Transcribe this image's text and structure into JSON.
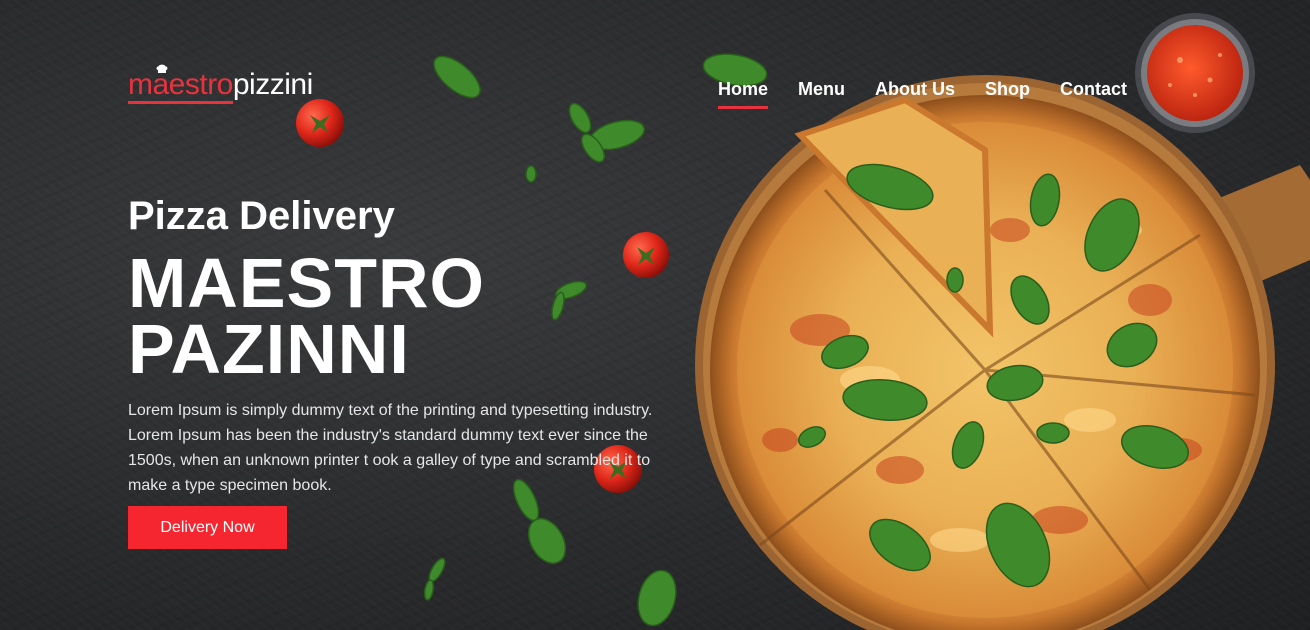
{
  "brand": {
    "part1": "maestro",
    "part2": "pizzini"
  },
  "nav": [
    {
      "label": "Home",
      "active": true
    },
    {
      "label": "Menu",
      "active": false
    },
    {
      "label": "About Us",
      "active": false
    },
    {
      "label": "Shop",
      "active": false
    },
    {
      "label": "Contact",
      "active": false
    }
  ],
  "hero": {
    "subtitle": "Pizza Delivery",
    "title_line1": "MAESTRO",
    "title_line2": "PAZINNI",
    "description": "Lorem Ipsum is simply dummy text of the printing and typesetting industry. Lorem Ipsum has been the industry's standard dummy text ever since the 1500s, when an unknown printer t ook a galley of type and scrambled it to make a type specimen book.",
    "cta_label": "Delivery Now"
  },
  "colors": {
    "accent": "#f5262f",
    "brand_red": "#e8333f",
    "background": "#2b2c2e"
  },
  "icons": [
    "chef-hat-icon"
  ]
}
